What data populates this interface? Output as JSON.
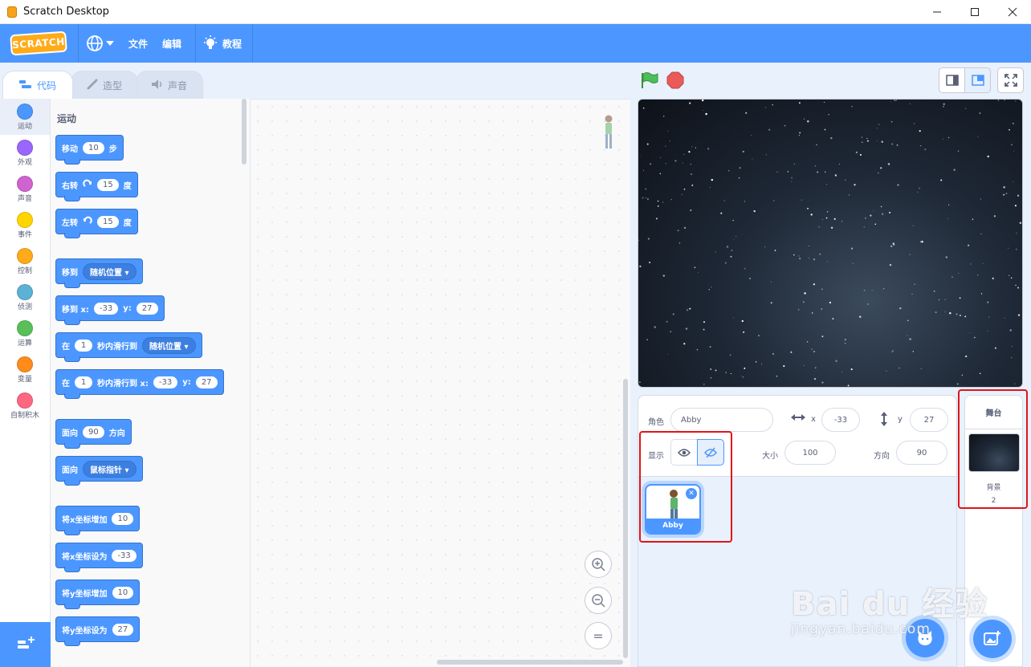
{
  "window": {
    "title": "Scratch Desktop"
  },
  "menubar": {
    "logo": "SCRATCH",
    "file": "文件",
    "edit": "编辑",
    "tutorials": "教程"
  },
  "tabs": [
    {
      "label": "代码",
      "icon": "code-icon"
    },
    {
      "label": "造型",
      "icon": "brush-icon"
    },
    {
      "label": "声音",
      "icon": "speaker-icon"
    }
  ],
  "categories": [
    {
      "label": "运动",
      "color": "#4c97ff"
    },
    {
      "label": "外观",
      "color": "#9966ff"
    },
    {
      "label": "声音",
      "color": "#cf63cf"
    },
    {
      "label": "事件",
      "color": "#ffd500"
    },
    {
      "label": "控制",
      "color": "#ffab19"
    },
    {
      "label": "侦测",
      "color": "#5cb1d6"
    },
    {
      "label": "运算",
      "color": "#59c059"
    },
    {
      "label": "变量",
      "color": "#ff8c1a"
    },
    {
      "label": "自制积木",
      "color": "#ff6680"
    }
  ],
  "palette": {
    "section_title": "运动",
    "blocks": {
      "move": {
        "a": "移动",
        "v": "10",
        "b": "步"
      },
      "turn_right": {
        "a": "右转",
        "v": "15",
        "b": "度"
      },
      "turn_left": {
        "a": "左转",
        "v": "15",
        "b": "度"
      },
      "goto": {
        "a": "移到",
        "d": "随机位置"
      },
      "goto_xy": {
        "a": "移到 x:",
        "x": "-33",
        "b": "y:",
        "y": "27"
      },
      "glide": {
        "a": "在",
        "v": "1",
        "b": "秒内滑行到",
        "d": "随机位置"
      },
      "glide_xy": {
        "a": "在",
        "v": "1",
        "b": "秒内滑行到 x:",
        "x": "-33",
        "c": "y:",
        "y": "27"
      },
      "point": {
        "a": "面向",
        "v": "90",
        "b": "方向"
      },
      "point_towards": {
        "a": "面向",
        "d": "鼠标指针"
      },
      "change_x": {
        "a": "将x坐标增加",
        "v": "10"
      },
      "set_x": {
        "a": "将x坐标设为",
        "v": "-33"
      },
      "change_y": {
        "a": "将y坐标增加",
        "v": "10"
      },
      "set_y": {
        "a": "将y坐标设为",
        "v": "27"
      }
    }
  },
  "zoom": {
    "in": "+",
    "out": "−",
    "reset": "="
  },
  "sprite_info": {
    "sprite_label": "角色",
    "sprite_name": "Abby",
    "x_label": "x",
    "x_value": "-33",
    "y_label": "y",
    "y_value": "27",
    "show_label": "显示",
    "size_label": "大小",
    "size_value": "100",
    "direction_label": "方向",
    "direction_value": "90"
  },
  "sprites": [
    {
      "name": "Abby"
    }
  ],
  "stage_selector": {
    "header": "舞台",
    "backdrops_label": "背景",
    "backdrops_count": "2"
  },
  "watermark": {
    "brand": "Bai du 经验",
    "url": "jingyan.baidu.com"
  },
  "colors": {
    "accent": "#4c97ff",
    "menu_bar": "#4c97ff",
    "annotation": "#e0141c",
    "flag": "#4cbf56",
    "stop": "#ec5959"
  }
}
